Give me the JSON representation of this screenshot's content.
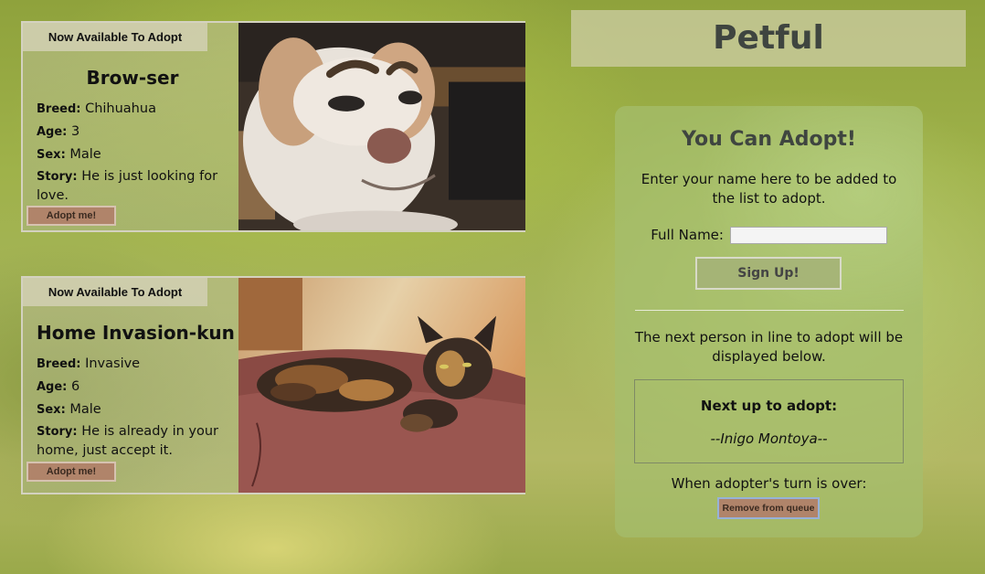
{
  "app": {
    "title": "Petful"
  },
  "pets": [
    {
      "banner": "Now Available To Adopt",
      "name": "Brow-ser",
      "breed_label": "Breed:",
      "breed": "Chihuahua",
      "age_label": "Age:",
      "age": "3",
      "sex_label": "Sex:",
      "sex": "Male",
      "story_label": "Story:",
      "story": "He is just looking for love.",
      "adopt_label": "Adopt me!",
      "photo_icon": "chihuahua-photo"
    },
    {
      "banner": "Now Available To Adopt",
      "name": "Home Invasion-kun",
      "breed_label": "Breed:",
      "breed": "Invasive",
      "age_label": "Age:",
      "age": "6",
      "sex_label": "Sex:",
      "sex": "Male",
      "story_label": "Story:",
      "story": "He is already in your home, just accept it.",
      "adopt_label": "Adopt me!",
      "photo_icon": "tortoiseshell-cat-photo"
    }
  ],
  "signup": {
    "heading": "You Can Adopt!",
    "intro": "Enter your name here to be added to the list to adopt.",
    "name_label": "Full Name:",
    "name_value": "",
    "name_placeholder": "",
    "button": "Sign Up!"
  },
  "queue": {
    "info": "The next person in line to adopt will be displayed below.",
    "next_heading": "Next up to adopt:",
    "next_name": "--Inigo Montoya--",
    "turn_text": "When adopter's turn is over:",
    "remove_button": "Remove from queue"
  },
  "colors": {
    "button_bg": "#b0846a",
    "title_text": "#3f4540"
  }
}
